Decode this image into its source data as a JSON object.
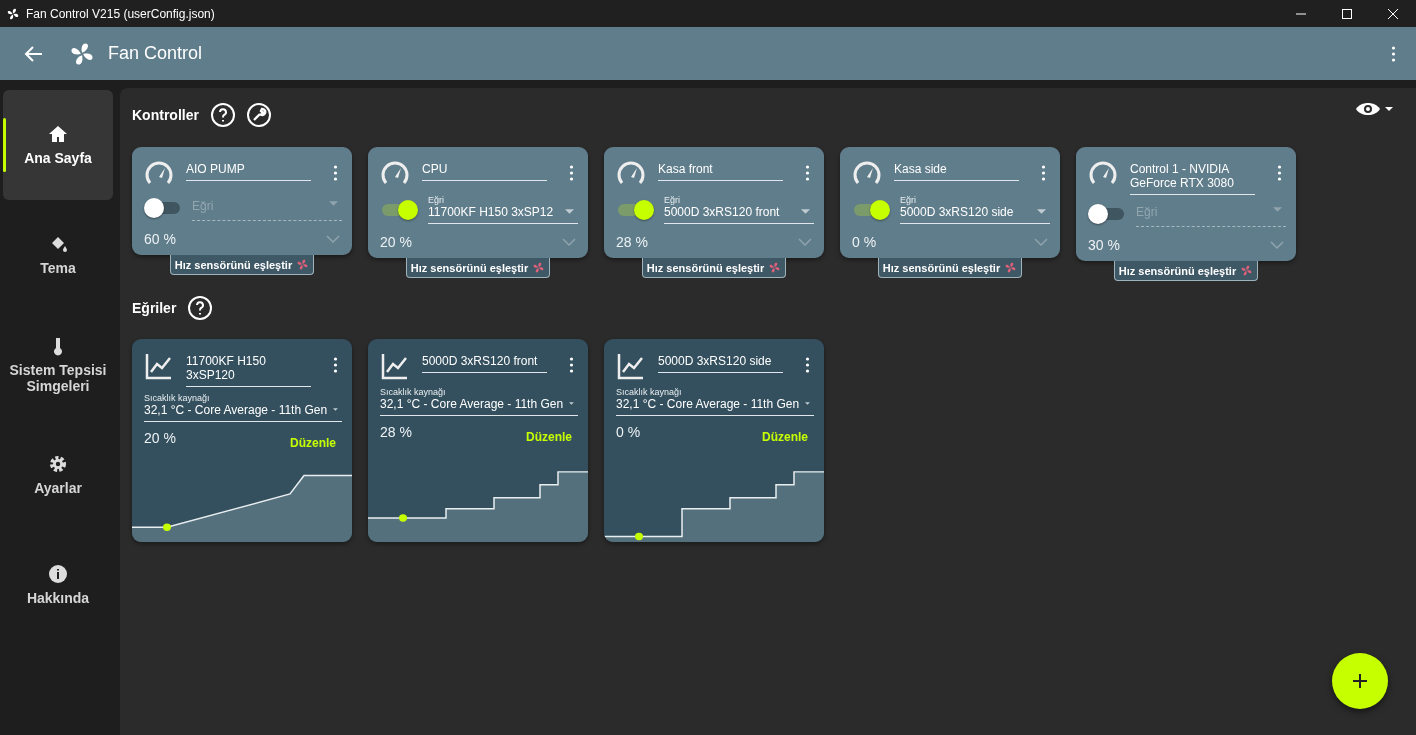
{
  "window": {
    "title": "Fan Control V215 (userConfig.json)"
  },
  "header": {
    "title": "Fan Control"
  },
  "sidebar": {
    "items": [
      {
        "label": "Ana Sayfa",
        "selected": true
      },
      {
        "label": "Tema",
        "selected": false
      },
      {
        "label": "Sistem Tepsisi Simgeleri",
        "selected": false
      },
      {
        "label": "Ayarlar",
        "selected": false
      },
      {
        "label": "Hakkında",
        "selected": false
      }
    ]
  },
  "controls": {
    "title": "Kontroller",
    "cards": [
      {
        "name": "AIO PUMP",
        "on": false,
        "curve_label": "Eğri",
        "value": "60 %",
        "pair_button": "Hız sensörünü eşleştir"
      },
      {
        "name": "CPU",
        "on": true,
        "curve_label": "Eğri",
        "curve": "11700KF H150 3xSP12",
        "value": "20 %",
        "pair_button": "Hız sensörünü eşleştir"
      },
      {
        "name": "Kasa front",
        "on": true,
        "curve_label": "Eğri",
        "curve": "5000D 3xRS120 front",
        "value": "28 %",
        "pair_button": "Hız sensörünü eşleştir"
      },
      {
        "name": "Kasa side",
        "on": true,
        "curve_label": "Eğri",
        "curve": "5000D 3xRS120 side",
        "value": "0 %",
        "pair_button": "Hız sensörünü eşleştir"
      },
      {
        "name": "Control 1 - NVIDIA GeForce RTX 3080",
        "on": false,
        "curve_label": "Eğri",
        "value": "30 %",
        "pair_button": "Hız sensörünü eşleştir"
      }
    ]
  },
  "curves": {
    "title": "Eğriler",
    "cards": [
      {
        "name": "11700KF H150 3xSP120",
        "kind": "linear",
        "source_label": "Sıcaklık kaynağı",
        "source": "32,1 °C - Core Average - 11th Gen",
        "value": "20 %",
        "edit_button": "Düzenle"
      },
      {
        "name": "5000D 3xRS120 front",
        "kind": "steps",
        "source_label": "Sıcaklık kaynağı",
        "source": "32,1 °C - Core Average - 11th Gen",
        "value": "28 %",
        "edit_button": "Düzenle"
      },
      {
        "name": "5000D 3xRS120 side",
        "kind": "steps-low",
        "source_label": "Sıcaklık kaynağı",
        "source": "32,1 °C - Core Average - 11th Gen",
        "value": "0 %",
        "edit_button": "Düzenle"
      }
    ]
  }
}
